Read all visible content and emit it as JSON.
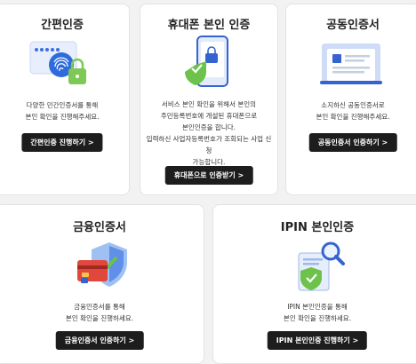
{
  "cards": [
    {
      "title": "간편인증",
      "desc": [
        "다양한 민간인증서를 통해",
        "본인 확인을 진행해주세요."
      ],
      "button": "간편인증 진행하기 >",
      "icon": "fingerprint-icon"
    },
    {
      "title": "휴대폰 본인 인증",
      "desc": [
        "서비스 본인 확인을 위해서 본인의",
        "주민등록번호에 개설된 휴대폰으로",
        "본인인증을 합니다.",
        "입력하신 사업자등록번호가 조회되는 사업 신청",
        "가능합니다."
      ],
      "button": "휴대폰으로 인증받기 >",
      "icon": "phone-lock-icon"
    },
    {
      "title": "공동인증서",
      "desc": [
        "소지하신 공동인증서로",
        "본인 확인을 진행해주세요."
      ],
      "button": "공동인증서 인증하기 >",
      "icon": "certificate-icon"
    },
    {
      "title": "금융인증서",
      "desc": [
        "금융인증서를 통해",
        "본인 확인을 진행하세요."
      ],
      "button": "금융인증서 인증하기 >",
      "icon": "card-shield-icon"
    },
    {
      "title": "IPIN 본인인증",
      "desc": [
        "IPIN 본인인증을 통해",
        "본인 확인을 진행하세요."
      ],
      "button": "IPIN 본인인증 진행하기 >",
      "icon": "document-search-icon"
    }
  ]
}
